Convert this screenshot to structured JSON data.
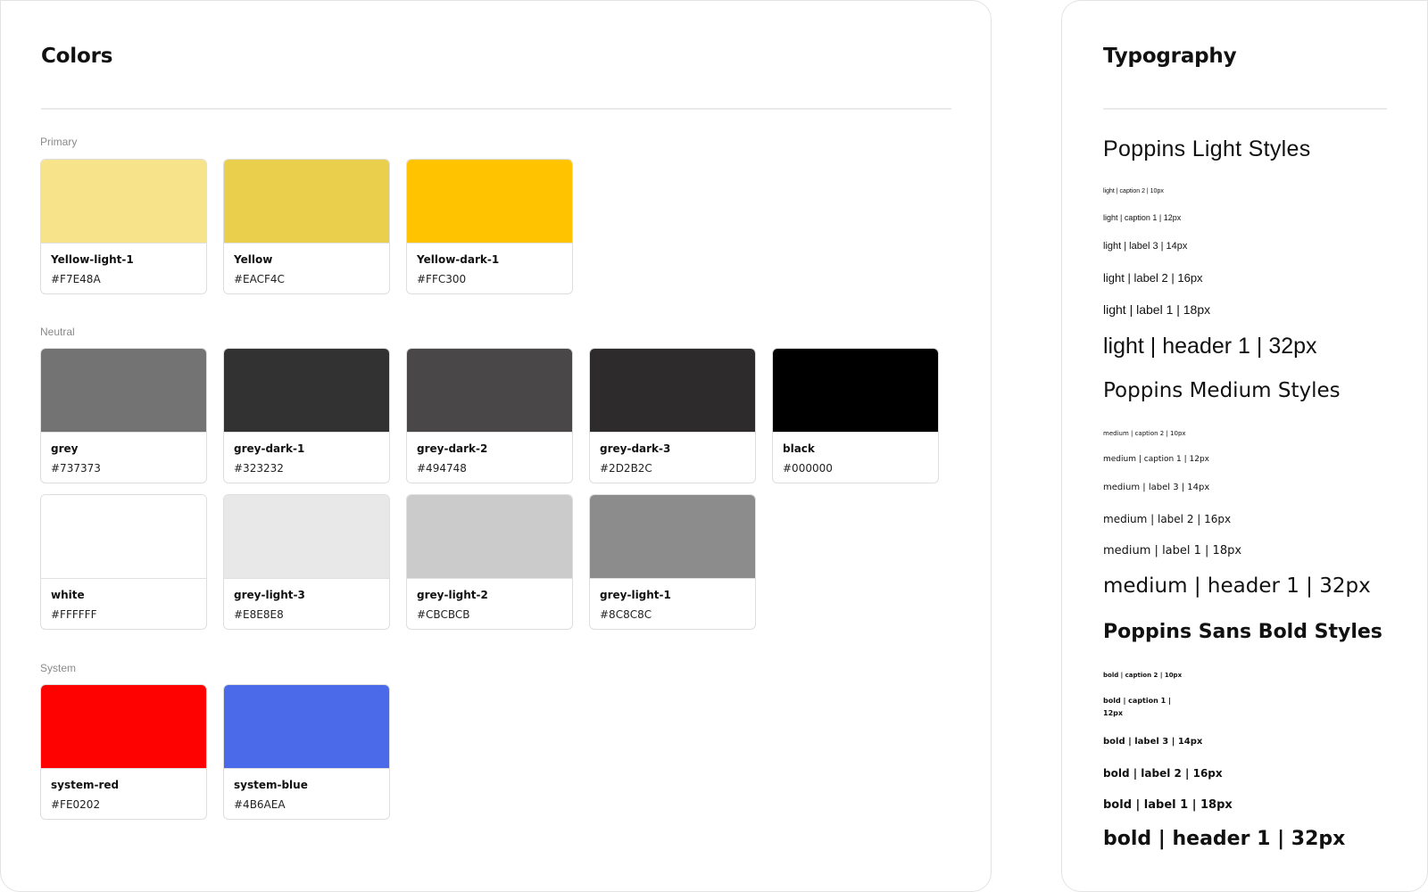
{
  "colors_panel": {
    "title": "Colors",
    "groups": [
      {
        "label": "Primary",
        "rows": [
          [
            {
              "name": "Yellow-light-1",
              "hex": "#F7E48A"
            },
            {
              "name": "Yellow",
              "hex": "#EACF4C"
            },
            {
              "name": "Yellow-dark-1",
              "hex": "#FFC300"
            }
          ]
        ]
      },
      {
        "label": "Neutral",
        "rows": [
          [
            {
              "name": "grey",
              "hex": "#737373"
            },
            {
              "name": "grey-dark-1",
              "hex": "#323232"
            },
            {
              "name": "grey-dark-2",
              "hex": "#494748"
            },
            {
              "name": "grey-dark-3",
              "hex": "#2D2B2C"
            },
            {
              "name": "black",
              "hex": "#000000"
            }
          ],
          [
            {
              "name": "white",
              "hex": "#FFFFFF"
            },
            {
              "name": "grey-light-3",
              "hex": "#E8E8E8"
            },
            {
              "name": "grey-light-2",
              "hex": "#CBCBCB"
            },
            {
              "name": "grey-light-1",
              "hex": "#8C8C8C"
            }
          ]
        ]
      },
      {
        "label": "System",
        "rows": [
          [
            {
              "name": "system-red",
              "hex": "#FE0202"
            },
            {
              "name": "system-blue",
              "hex": "#4B6AEA"
            }
          ]
        ]
      }
    ]
  },
  "typography_panel": {
    "title": "Typography",
    "light_title": "Poppins Light Styles",
    "light_caption2": "light | caption 2 | 10px",
    "light_caption1": "light | caption 1 | 12px",
    "light_label3": "light | label 3 | 14px",
    "light_label2": "light | label 2 | 16px",
    "light_label1": "light | label 1 | 18px",
    "light_header1": "light | header 1 | 32px",
    "medium_title": "Poppins Medium Styles",
    "medium_caption2": "medium | caption 2 | 10px",
    "medium_caption1": "medium | caption 1 | 12px",
    "medium_label3": "medium | label 3 | 14px",
    "medium_label2": "medium | label 2 | 16px",
    "medium_label1": "medium | label 1 | 18px",
    "medium_header1": "medium | header 1 | 32px",
    "bold_title": "Poppins Sans Bold Styles",
    "bold_caption2": "bold | caption 2 | 10px",
    "bold_caption1_line1": "bold | caption 1 |",
    "bold_caption1_line2": "12px",
    "bold_label3": "bold | label 3 | 14px",
    "bold_label2": "bold | label 2 | 16px",
    "bold_label1": "bold | label 1 | 18px",
    "bold_header1": "bold | header 1 | 32px"
  }
}
